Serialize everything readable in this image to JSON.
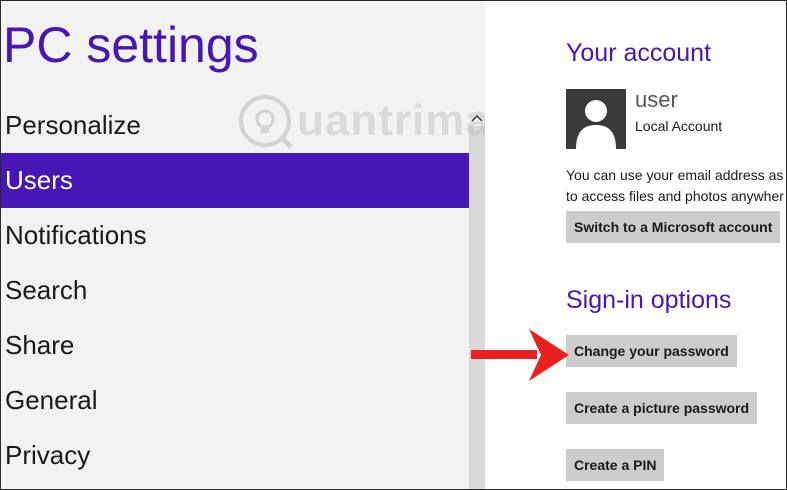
{
  "left": {
    "title": "PC settings",
    "nav": [
      {
        "label": "Personalize"
      },
      {
        "label": "Users"
      },
      {
        "label": "Notifications"
      },
      {
        "label": "Search"
      },
      {
        "label": "Share"
      },
      {
        "label": "General"
      },
      {
        "label": "Privacy"
      }
    ],
    "selected": "Users"
  },
  "watermark": {
    "text": "uantrimang"
  },
  "right": {
    "account_title": "Your account",
    "user_name": "user",
    "account_type": "Local Account",
    "desc_line1": "You can use your email address as",
    "desc_line2": "to access files and photos anywher",
    "switch_button": "Switch to a Microsoft account",
    "signin_title": "Sign-in options",
    "change_password_button": "Change your password",
    "picture_password_button": "Create a picture password",
    "pin_button": "Create a PIN"
  },
  "colors": {
    "accent": "#4617b4",
    "arrow": "#e8201f",
    "button_bg": "#cccccc"
  },
  "icons": {
    "avatar": "user-silhouette-icon",
    "scroll_up": "chevron-up-icon",
    "annotation": "red-arrow-icon"
  }
}
